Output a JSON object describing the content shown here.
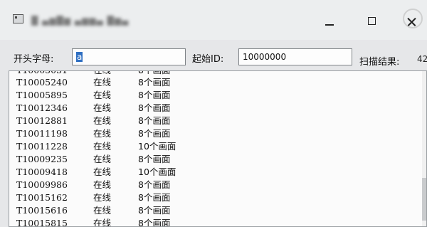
{
  "window": {
    "title": "█ ▄▆█▆ ▄▆▆▄ █▆▄"
  },
  "form": {
    "prefix_label": "开头字母:",
    "prefix_value": "a",
    "start_label": "起始ID:",
    "start_value": "10000000",
    "result_label": "扫描结果:",
    "result_value": "42"
  },
  "list": {
    "rows": [
      {
        "id": "T10005240",
        "status": "在线",
        "count": "8个画面"
      },
      {
        "id": "T10005895",
        "status": "在线",
        "count": "8个画面"
      },
      {
        "id": "T10012346",
        "status": "在线",
        "count": "8个画面"
      },
      {
        "id": "T10012881",
        "status": "在线",
        "count": "8个画面"
      },
      {
        "id": "T10011198",
        "status": "在线",
        "count": "8个画面"
      },
      {
        "id": "T10011228",
        "status": "在线",
        "count": "10个画面"
      },
      {
        "id": "T10009235",
        "status": "在线",
        "count": "8个画面"
      },
      {
        "id": "T10009418",
        "status": "在线",
        "count": "10个画面"
      },
      {
        "id": "T10009986",
        "status": "在线",
        "count": "8个画面"
      },
      {
        "id": "T10015162",
        "status": "在线",
        "count": "8个画面"
      },
      {
        "id": "T10015616",
        "status": "在线",
        "count": "8个画面"
      }
    ]
  }
}
